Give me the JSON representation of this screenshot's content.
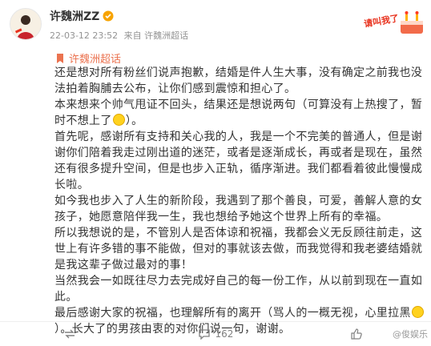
{
  "post": {
    "author": "许魏洲ZZ",
    "timestamp": "22-03-12 23:52",
    "source": "来自 许魏洲超话",
    "supertopic": "许魏洲超话",
    "badge_text": "请叫我了",
    "paragraphs": [
      "还是想对所有粉丝们说声抱歉，结婚是件人生大事，没有确定之前我也没法拍着胸脯去公布，让你们感到震惊和担心了。",
      "本来想来个帅气甩证不回头，结果还是想说两句（可算没有上热搜了，暂时不想上了",
      "）。",
      "首先呢，感谢所有支持和关心我的人，我是一个不完美的普通人，但是谢谢你们陪着我走过刚出道的迷茫，或者是逐渐成长，再或者是现在，虽然还有很多提升空间，但是也步入正轨，循序渐进。我们都看着彼此慢慢成长啦。",
      "如今我也步入了人生的新阶段，我遇到了那个善良，可爱，善解人意的女孩子，她愿意陪伴我一生，我也想给予她这个世界上所有的幸福。",
      "所以我想说的是，不管別人是否体谅和祝福，我都会义无反顾往前走，这世上有许多错的事不能做，但对的事就该去做，而我觉得和我老婆结婚就是我这辈子做过最对的事！",
      "当然我会一如既往尽力去完成好自己的每一份工作，从以前到现在一直如此。",
      "最后感谢大家的祝福，也理解所有的离开（骂人的一概无视，心里拉黑",
      "）。长大了的男孩由衷的对你们说一句，谢谢。"
    ],
    "actions": {
      "repost_count": "",
      "comment_count": "162",
      "like_count": ""
    },
    "watermark": "@俊娱乐"
  },
  "colors": {
    "accent": "#eb7350",
    "meta": "#939393",
    "verified": "#f7a300"
  },
  "icons": [
    "avatar",
    "verified-badge-icon",
    "supertopic-icon",
    "repost-icon",
    "comment-icon",
    "like-icon",
    "grin-emoji-icon",
    "drool-emoji-icon"
  ]
}
